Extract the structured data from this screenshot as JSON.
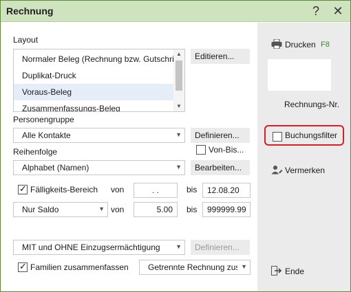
{
  "window": {
    "title": "Rechnung",
    "help_label": "?",
    "close_label": "✕"
  },
  "layout": {
    "label": "Layout",
    "items": [
      "Normaler Beleg (Rechnung bzw. Gutschrift)",
      "Duplikat-Druck",
      "Voraus-Beleg",
      "Zusammenfassungs-Beleg"
    ],
    "selected": "Voraus-Beleg",
    "edit_button": "Editieren..."
  },
  "personengruppe": {
    "label": "Personengruppe",
    "value": "Alle Kontakte",
    "define_button": "Definieren...",
    "von_bis_label": "Von-Bis..."
  },
  "reihenfolge": {
    "label": "Reihenfolge",
    "value": "Alphabet (Namen)",
    "edit_button": "Bearbeiten..."
  },
  "faelligkeit": {
    "checkbox_label": "Fälligkeits-Bereich",
    "checked": true,
    "von_label": "von",
    "von_value": ". .",
    "bis_label": "bis",
    "bis_value": "12.08.20"
  },
  "saldo": {
    "value": "Nur Saldo",
    "von_label": "von",
    "von_value": "5.00",
    "bis_label": "bis",
    "bis_value": "999999.99"
  },
  "einzug": {
    "value": "MIT und OHNE Einzugsermächtigung",
    "define_button": "Definieren..."
  },
  "familien": {
    "checkbox_label": "Familien zusammenfassen",
    "checked": true,
    "mode_value": "Getrennte Rechnung zusä"
  },
  "sidebar": {
    "print_label": "Drucken",
    "print_shortcut": "F8",
    "invoice_nr_label": "Rechnungs-Nr.",
    "booking_filter_label": "Buchungsfilter",
    "note_label": "Vermerken",
    "end_label": "Ende"
  },
  "colors": {
    "accent_green": "#2e8b1e",
    "highlight_red": "#e01b24",
    "titlebar": "#cfe3bf"
  }
}
